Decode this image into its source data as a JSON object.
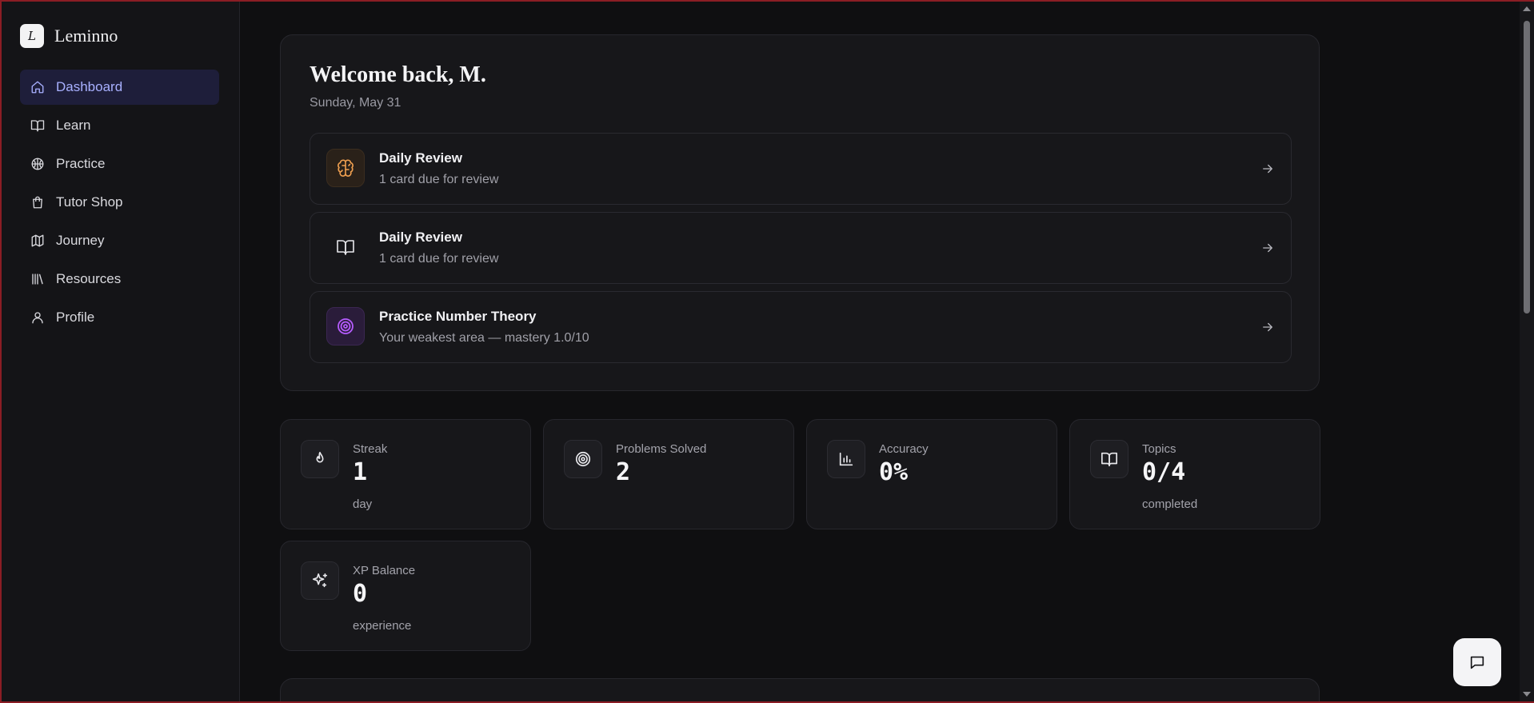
{
  "brand": {
    "logo_letter": "L",
    "name": "Leminno"
  },
  "sidebar": {
    "items": [
      {
        "label": "Dashboard",
        "icon": "home-icon",
        "active": true
      },
      {
        "label": "Learn",
        "icon": "book-open-icon"
      },
      {
        "label": "Practice",
        "icon": "ball-icon"
      },
      {
        "label": "Tutor Shop",
        "icon": "shopping-bag-icon"
      },
      {
        "label": "Journey",
        "icon": "map-icon"
      },
      {
        "label": "Resources",
        "icon": "library-icon"
      },
      {
        "label": "Profile",
        "icon": "user-icon"
      }
    ]
  },
  "welcome": {
    "title": "Welcome back, M.",
    "date": "Sunday, May 31",
    "actions": [
      {
        "title": "Daily Review",
        "subtitle": "1 card due for review",
        "icon": "brain-icon"
      },
      {
        "title": "Daily Review",
        "subtitle": "1 card due for review",
        "icon": "book-open-icon"
      },
      {
        "title": "Practice Number Theory",
        "subtitle": "Your weakest area — mastery 1.0/10",
        "icon": "target-icon"
      }
    ]
  },
  "stats": [
    {
      "label": "Streak",
      "value": "1",
      "unit": "day",
      "icon": "flame-icon"
    },
    {
      "label": "Problems Solved",
      "value": "2",
      "unit": "",
      "icon": "target-icon"
    },
    {
      "label": "Accuracy",
      "value": "0%",
      "unit": "",
      "icon": "bar-chart-icon"
    },
    {
      "label": "Topics",
      "value": "0/4",
      "unit": "completed",
      "icon": "book-open-icon"
    },
    {
      "label": "XP Balance",
      "value": "0",
      "unit": "experience",
      "icon": "sparkles-icon"
    }
  ],
  "colors": {
    "background": "#0f0f11",
    "sidebar": "#141417",
    "active_nav_bg": "#1e1e3a",
    "active_nav_text": "#a8b0ff",
    "brain_accent": "#f0a050",
    "target_accent": "#b65cff"
  }
}
